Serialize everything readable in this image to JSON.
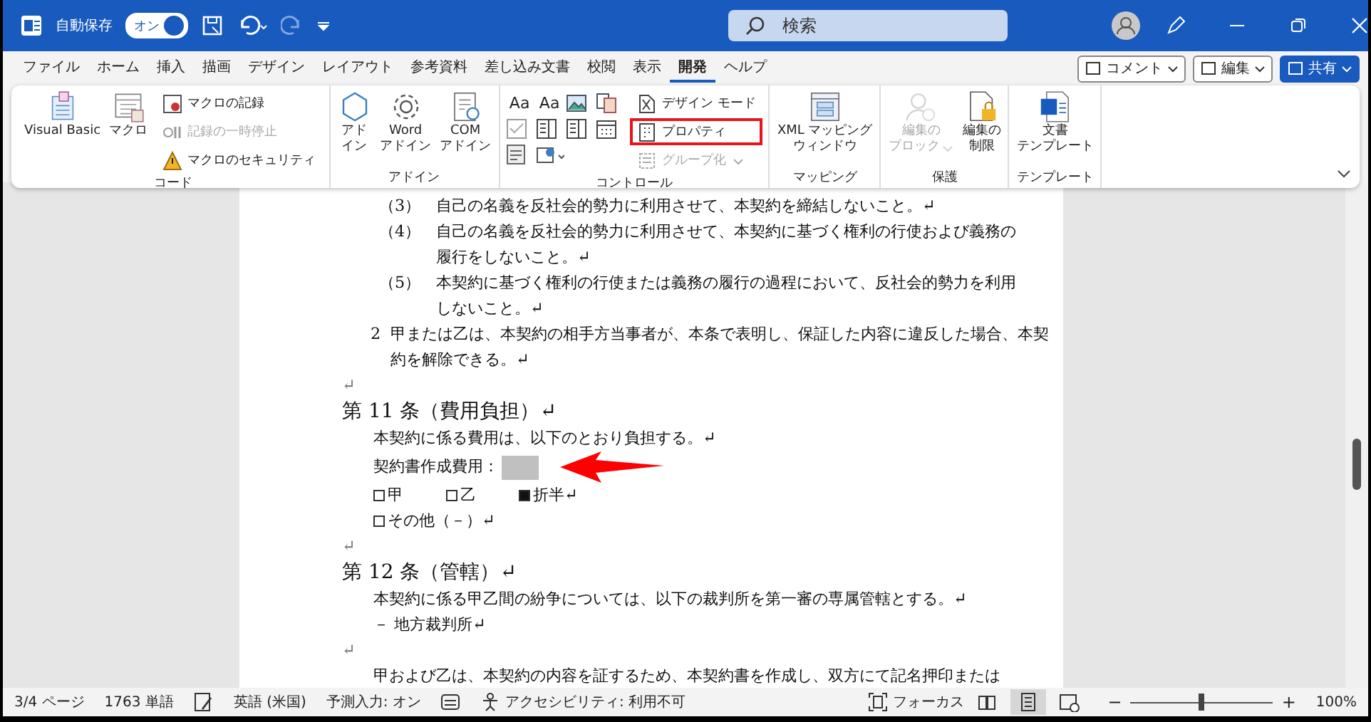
{
  "title_bar": {
    "autosave_label": "自動保存",
    "autosave": {
      "label": "オン",
      "on": true
    },
    "search": {
      "placeholder": "検索"
    }
  },
  "tabs": [
    {
      "label": "ファイル",
      "selected": false
    },
    {
      "label": "ホーム",
      "selected": false
    },
    {
      "label": "挿入",
      "selected": false
    },
    {
      "label": "描画",
      "selected": false
    },
    {
      "label": "デザイン",
      "selected": false
    },
    {
      "label": "レイアウト",
      "selected": false
    },
    {
      "label": "参考資料",
      "selected": false
    },
    {
      "label": "差し込み文書",
      "selected": false
    },
    {
      "label": "校閲",
      "selected": false
    },
    {
      "label": "表示",
      "selected": false
    },
    {
      "label": "開発",
      "selected": true
    },
    {
      "label": "ヘルプ",
      "selected": false
    }
  ],
  "actions": [
    {
      "label": "コメント",
      "kind": "outline"
    },
    {
      "label": "編集",
      "kind": "outline"
    },
    {
      "label": "共有",
      "kind": "primary"
    }
  ],
  "ribbon": {
    "groups": [
      {
        "label": "コード",
        "columns": [
          {
            "kind": "large",
            "lines": [
              "Visual Basic"
            ],
            "disabled": false
          },
          {
            "kind": "large",
            "lines": [
              "マクロ"
            ],
            "disabled": false
          },
          {
            "kind": "stack",
            "items": [
              {
                "label": "マクロの記録",
                "disabled": false,
                "highlighted": false
              },
              {
                "label": "記録の一時停止",
                "disabled": true,
                "highlighted": false
              },
              {
                "label": "マクロのセキュリティ",
                "disabled": false,
                "highlighted": false
              }
            ]
          }
        ]
      },
      {
        "label": "アドイン",
        "columns": [
          {
            "kind": "large",
            "lines": [
              "アド",
              "イン"
            ],
            "disabled": false
          },
          {
            "kind": "large",
            "lines": [
              "Word",
              "アドイン"
            ],
            "disabled": false
          },
          {
            "kind": "large",
            "lines": [
              "COM",
              "アドイン"
            ],
            "disabled": false
          }
        ]
      },
      {
        "label": "コントロール",
        "columns": [
          {
            "kind": "grid",
            "cells": [
              {
                "kind": "text",
                "text": "Aa"
              },
              {
                "kind": "text",
                "text": "Aa"
              },
              {
                "kind": "icon"
              },
              {
                "kind": "icon"
              },
              {
                "kind": "icon"
              },
              {
                "kind": "icon"
              },
              {
                "kind": "icon"
              },
              {
                "kind": "icon"
              },
              {
                "kind": "icon"
              },
              {
                "kind": "icon"
              }
            ]
          },
          {
            "kind": "stack",
            "items": [
              {
                "label": "デザイン モード",
                "disabled": false,
                "highlighted": false
              },
              {
                "label": "プロパティ",
                "disabled": false,
                "highlighted": true
              },
              {
                "label": "グループ化",
                "disabled": true,
                "highlighted": false
              }
            ]
          }
        ]
      },
      {
        "label": "マッピング",
        "columns": [
          {
            "kind": "large",
            "lines": [
              "XML マッピング",
              "ウィンドウ"
            ],
            "disabled": false
          }
        ]
      },
      {
        "label": "保護",
        "columns": [
          {
            "kind": "large",
            "lines": [
              "編集の",
              "ブロック"
            ],
            "disabled": true
          },
          {
            "kind": "large",
            "lines": [
              "編集の",
              "制限"
            ],
            "disabled": false
          }
        ]
      },
      {
        "label": "テンプレート",
        "columns": [
          {
            "kind": "large",
            "lines": [
              "文書",
              "テンプレート"
            ],
            "disabled": false
          }
        ]
      }
    ]
  },
  "document": {
    "paragraphs": [
      {
        "kind": "item",
        "number": "（3）",
        "text": "自己の名義を反社会的勢力に利用させて、本契約を締結しないこと。↵"
      },
      {
        "kind": "item",
        "number": "（4）",
        "text": "自己の名義を反社会的勢力に利用させて、本契約に基づく権利の行使および義務の履行をしないこと。↵"
      },
      {
        "kind": "item",
        "number": "（5）",
        "text": "本契約に基づく権利の行使または義務の履行の過程において、反社会的勢力を利用しないこと。↵"
      },
      {
        "kind": "numbered",
        "number": "2",
        "text": "甲または乙は、本契約の相手方当事者が、本条で表明し、保証した内容に違反した場合、本契約を解除できる。↵"
      },
      {
        "kind": "empty",
        "text": "↵"
      },
      {
        "kind": "heading",
        "text": "第 11 条（費用負担）↵"
      },
      {
        "kind": "body",
        "text": "本契約に係る費用は、以下のとおり負担する。↵"
      },
      {
        "kind": "field",
        "label": "契約書作成費用："
      },
      {
        "kind": "options",
        "options": [
          {
            "label": "甲",
            "checked": false
          },
          {
            "label": "乙",
            "checked": false
          },
          {
            "label": "折半↵",
            "checked": true
          }
        ]
      },
      {
        "kind": "options",
        "options": [
          {
            "label": "その他（－）↵",
            "checked": false
          }
        ]
      },
      {
        "kind": "empty",
        "text": "↵"
      },
      {
        "kind": "heading",
        "text": "第 12 条（管轄）↵"
      },
      {
        "kind": "body",
        "text": "本契約に係る甲乙間の紛争については、以下の裁判所を第一審の専属管轄とする。↵"
      },
      {
        "kind": "body",
        "text": " － 地方裁判所↵"
      },
      {
        "kind": "empty",
        "text": "↵"
      },
      {
        "kind": "body",
        "text": "甲および乙は、本契約の内容を証するため、本契約書を作成し、双方にて記名押印または"
      }
    ]
  },
  "status_bar": {
    "left": [
      {
        "kind": "text",
        "text": "3/4 ページ"
      },
      {
        "kind": "text",
        "text": "1763 単語"
      },
      {
        "kind": "icon"
      },
      {
        "kind": "text",
        "text": "英語 (米国)"
      },
      {
        "kind": "text",
        "text": "予測入力: オン"
      },
      {
        "kind": "icon"
      },
      {
        "kind": "icon-text",
        "text": "アクセシビリティ: 利用不可"
      }
    ],
    "focus": "フォーカス",
    "views": [
      {
        "selected": false
      },
      {
        "selected": true
      },
      {
        "selected": false
      }
    ],
    "zoom_out": "−",
    "zoom_in": "+",
    "zoom": {
      "level": 0.5
    },
    "zoom_label": "100%"
  }
}
